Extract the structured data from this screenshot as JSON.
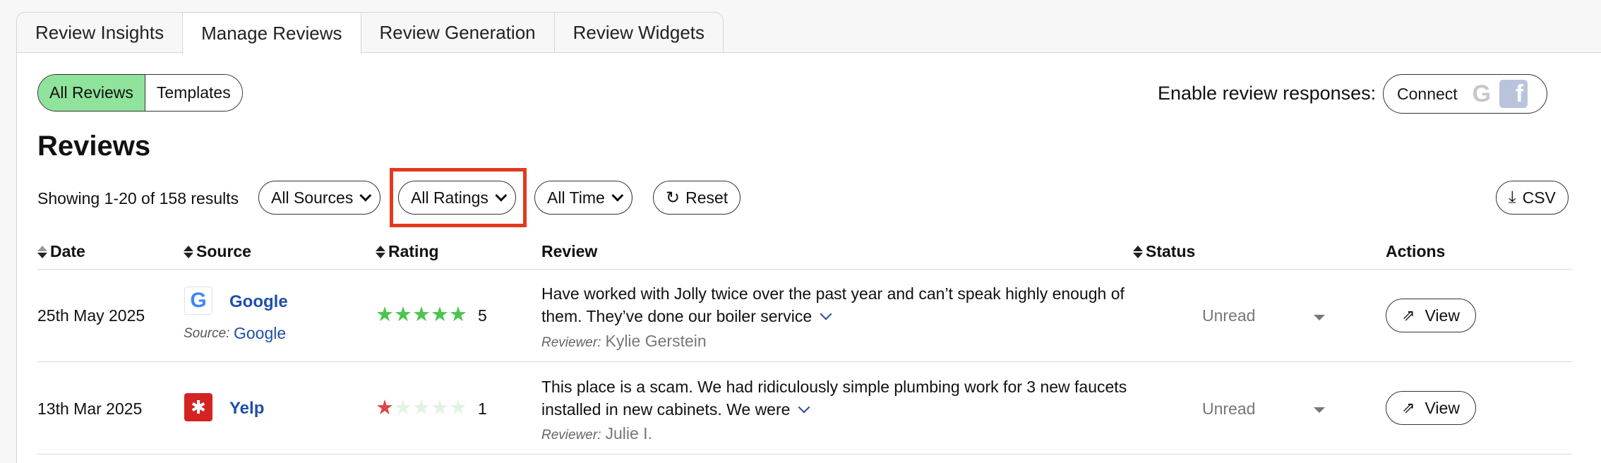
{
  "tabs": [
    "Review Insights",
    "Manage Reviews",
    "Review Generation",
    "Review Widgets"
  ],
  "active_tab": "Manage Reviews",
  "segment": {
    "all": "All Reviews",
    "templates": "Templates"
  },
  "enable_label": "Enable review responses:",
  "connect_label": "Connect",
  "title": "Reviews",
  "showing": "Showing 1-20 of 158 results",
  "filters": {
    "sources": "All Sources",
    "ratings": "All Ratings",
    "time": "All Time",
    "reset": "Reset",
    "csv": "CSV"
  },
  "columns": {
    "date": "Date",
    "source": "Source",
    "rating": "Rating",
    "review": "Review",
    "status": "Status",
    "actions": "Actions"
  },
  "rows": [
    {
      "date": "25th May 2025",
      "source": "Google",
      "source_sub_label": "Source:",
      "source_sub": "Google",
      "rating": 5,
      "review": "Have worked with Jolly twice over the past year and can’t speak highly enough of them. They’ve done our boiler service",
      "reviewer_label": "Reviewer:",
      "reviewer": "Kylie Gerstein",
      "status": "Unread",
      "action": "View"
    },
    {
      "date": "13th Mar 2025",
      "source": "Yelp",
      "rating": 1,
      "review": "This place is a scam. We had ridiculously simple plumbing work for 3 new faucets installed in new cabinets. We were",
      "reviewer_label": "Reviewer:",
      "reviewer": "Julie I.",
      "status": "Unread",
      "action": "View"
    }
  ],
  "icons": {
    "google": "google-icon",
    "facebook": "facebook-icon",
    "yelp": "yelp-icon",
    "reset": "refresh-icon",
    "csv": "download-icon",
    "view": "share-icon"
  },
  "colors": {
    "active_segment": "#8fe39a",
    "highlight": "#e23a1f",
    "star": "#4cc54e",
    "star_low": "#d94848",
    "link": "#1f4fa8"
  }
}
